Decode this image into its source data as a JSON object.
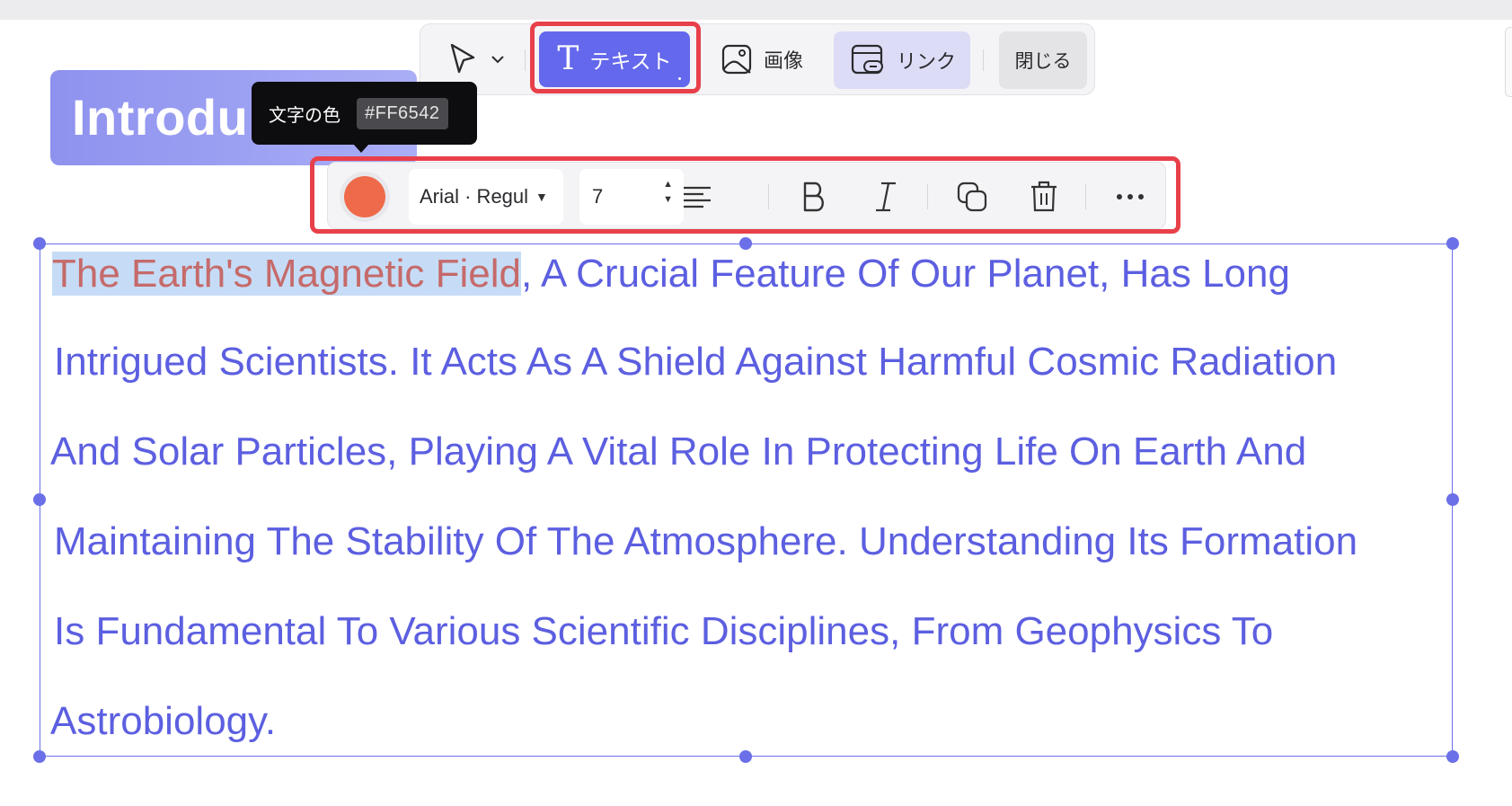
{
  "title_badge": {
    "text": "Introdu"
  },
  "top_toolbar": {
    "text_button_label": "テキスト",
    "image_button_label": "画像",
    "link_button_label": "リンク",
    "close_button_label": "閉じる"
  },
  "tooltip": {
    "label": "文字の色",
    "hex": "#FF6542"
  },
  "format_toolbar": {
    "text_color": "#FF6542",
    "font_select_label": "Arial · Regul",
    "font_size": "7"
  },
  "body": {
    "selected_text": "The Earth's Magnetic Field",
    "lines": [
      ", A Crucial Feature Of Our Planet, Has Long",
      "Intrigued Scientists. It Acts As A Shield Against Harmful Cosmic Radiation",
      "And Solar Particles, Playing A Vital Role In Protecting Life On Earth And",
      "Maintaining The Stability Of The Atmosphere. Understanding Its Formation",
      "Is Fundamental To Various Scientific Disciplines, From Geophysics To",
      "Astrobiology."
    ]
  },
  "colors": {
    "accent": "#6468EC",
    "body_text": "#5C5FE0",
    "highlight_border": "#E8404A",
    "text_color_swatch": "#FF6542"
  }
}
